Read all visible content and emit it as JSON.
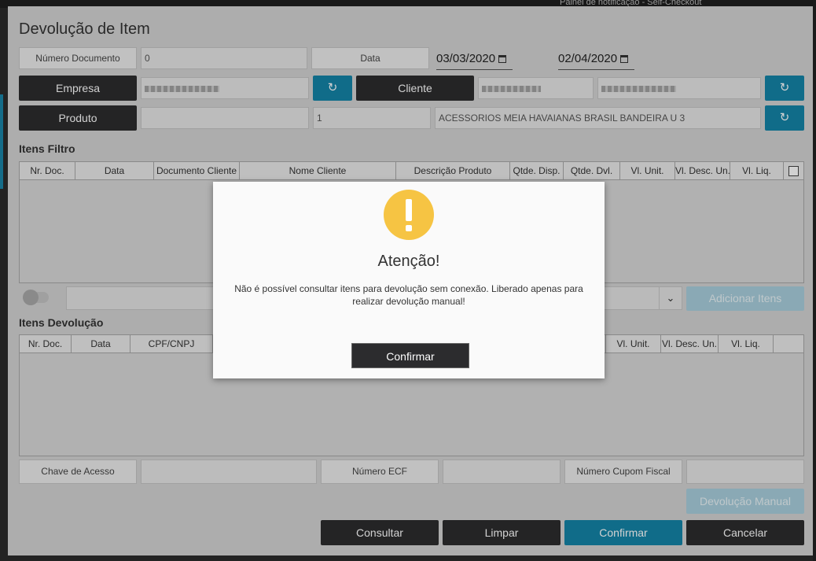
{
  "background": {
    "notification_text": "Painel de notificação - Self-Checkout"
  },
  "window": {
    "title": "Devolução de Item"
  },
  "filters": {
    "numero_documento_label": "Número Documento",
    "numero_documento_value": "0",
    "data_label": "Data",
    "date_from": "03/03/2020",
    "date_to": "02/04/2020",
    "empresa_button": "Empresa",
    "cliente_button": "Cliente",
    "produto_button": "Produto",
    "produto_qty": "1",
    "produto_desc": "ACESSORIOS MEIA HAVAIANAS BRASIL BANDEIRA U 3",
    "refresh_icon": "↻"
  },
  "itens_filtro": {
    "title": "Itens Filtro",
    "columns": [
      "Nr. Doc.",
      "Data",
      "Documento Cliente",
      "Nome Cliente",
      "Descrição Produto",
      "Qtde. Disp.",
      "Qtde. Dvl.",
      "Vl. Unit.",
      "Vl. Desc. Un.",
      "Vl. Liq."
    ]
  },
  "add_items": {
    "button": "Adicionar Itens",
    "chevron": "⌄"
  },
  "itens_devolucao": {
    "title": "Itens Devolução",
    "columns": [
      "Nr. Doc.",
      "Data",
      "CPF/CNPJ",
      "Vl. Unit.",
      "Vl. Desc. Un.",
      "Vl. Liq."
    ]
  },
  "bottom_fields": {
    "chave_acesso": "Chave de Acesso",
    "numero_ecf": "Número ECF",
    "numero_cupom": "Número Cupom Fiscal"
  },
  "actions": {
    "devolucao_manual": "Devolução Manual",
    "consultar": "Consultar",
    "limpar": "Limpar",
    "confirmar": "Confirmar",
    "cancelar": "Cancelar"
  },
  "modal": {
    "title": "Atenção!",
    "message": "Não é possível consultar itens para devolução sem conexão. Liberado apenas para realizar devolução manual!",
    "confirm": "Confirmar"
  },
  "colors": {
    "teal": "#1484a8",
    "dark": "#2c2c2e",
    "warning": "#f6c443"
  }
}
